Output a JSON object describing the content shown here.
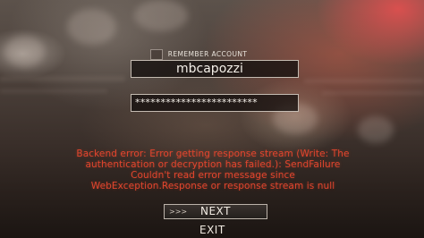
{
  "login": {
    "remember_label": "REMEMBER ACCOUNT",
    "username_value": "mbcapozzi",
    "password_value": "************************"
  },
  "error": {
    "line1": "Backend error: Error getting response stream (Write: The",
    "line2": "authentication or decryption has failed.): SendFailure",
    "line3": "Couldn't read error message since",
    "line4": "WebException.Response or response stream is null"
  },
  "buttons": {
    "next_arrows": ">>>",
    "next_label": "NEXT",
    "exit_label": "EXIT"
  },
  "colors": {
    "error_text": "#e2452e",
    "field_border": "#e1d7cd"
  }
}
